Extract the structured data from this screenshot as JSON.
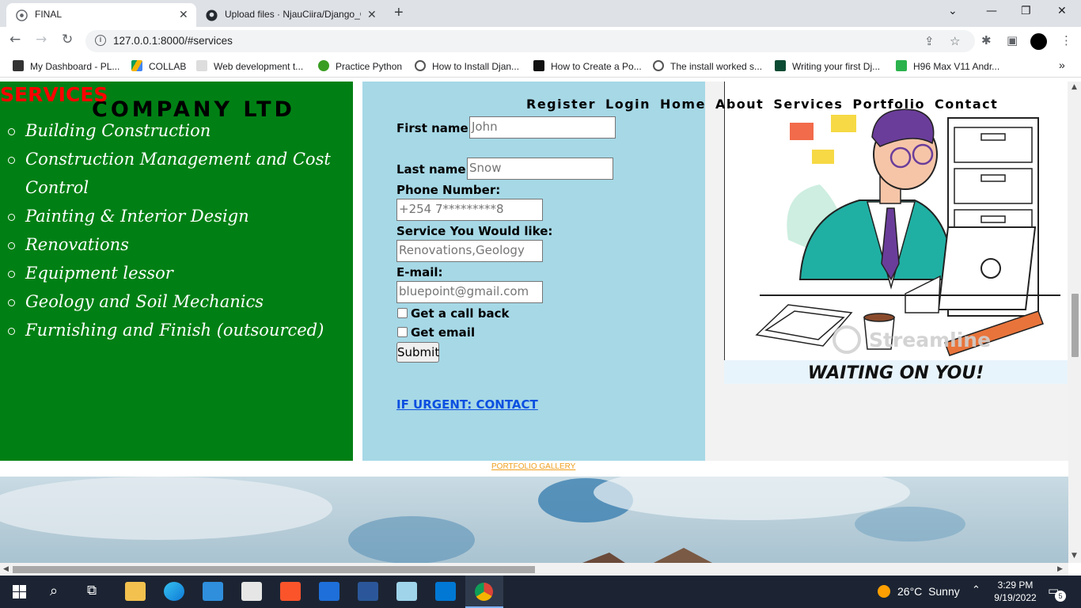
{
  "browser": {
    "tabs": [
      {
        "title": "FINAL",
        "active": true
      },
      {
        "title": "Upload files · NjauCiira/Django_C",
        "active": false
      }
    ],
    "url": "127.0.0.1:8000/#services",
    "bookmarks": [
      {
        "label": "My Dashboard - PL...",
        "icon": "dashboard-icon",
        "color": "#333"
      },
      {
        "label": "COLLAB",
        "icon": "drive-icon",
        "color": "#f4b400"
      },
      {
        "label": "Web development t...",
        "icon": "w3-icon",
        "color": "#888"
      },
      {
        "label": "Practice Python",
        "icon": "python-icon",
        "color": "#3a9d23"
      },
      {
        "label": "How to Install Djan...",
        "icon": "globe-icon",
        "color": "#555"
      },
      {
        "label": "How to Create a Po...",
        "icon": "site-icon",
        "color": "#111"
      },
      {
        "label": "The install worked s...",
        "icon": "globe-icon",
        "color": "#555"
      },
      {
        "label": "Writing your first Dj...",
        "icon": "django-icon",
        "color": "#0c4b33"
      },
      {
        "label": "H96 Max V11 Andr...",
        "icon": "shop-icon",
        "color": "#2bb24c"
      }
    ]
  },
  "page": {
    "services_title": "SERVICES",
    "company": "COMPANY LTD",
    "services": [
      "Building Construction",
      "Construction Management and Cost Control",
      "Painting & Interior Design",
      "Renovations",
      "Equipment lessor",
      "Geology and Soil Mechanics",
      "Furnishing and Finish (outsourced)"
    ],
    "nav": [
      "Register",
      "Login",
      "Home",
      "About",
      "Services",
      "Portfolio",
      "Contact"
    ],
    "form": {
      "first_name_label": "First name:",
      "first_name_placeholder": "John",
      "last_name_label": "Last name:",
      "last_name_placeholder": "Snow",
      "phone_label": "Phone Number:",
      "phone_placeholder": "+254 7*********8",
      "service_label": "Service You Would like:",
      "service_placeholder": "Renovations,Geology",
      "email_label": "E-mail:",
      "email_placeholder": "bluepoint@gmail.com",
      "callback_label": "Get a call back",
      "get_email_label": "Get email",
      "submit_label": "Submit"
    },
    "urgent_link": "IF URGENT: CONTACT",
    "waiting": "WAITING ON YOU!",
    "watermark": "Streamline",
    "portfolio_link": "PORTFOLIO GALLERY"
  },
  "taskbar": {
    "weather_temp": "26°C",
    "weather_text": "Sunny",
    "time": "3:29 PM",
    "date": "9/19/2022",
    "notifications": "5"
  }
}
